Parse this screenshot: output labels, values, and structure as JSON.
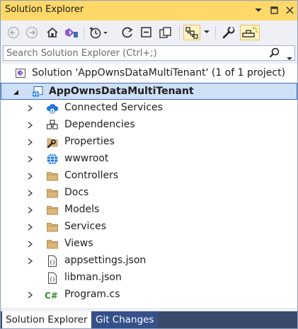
{
  "window": {
    "title": "Solution Explorer",
    "controls": [
      "dropdown-icon",
      "maximize-icon",
      "close-icon"
    ]
  },
  "toolbar": {
    "buttons": [
      {
        "name": "back-icon"
      },
      {
        "name": "forward-icon"
      },
      {
        "name": "home-icon"
      },
      {
        "name": "vs-switch-views-icon"
      },
      {
        "name": "pending-changes-filter-icon"
      },
      {
        "name": "refresh-icon"
      },
      {
        "name": "collapse-all-icon"
      },
      {
        "name": "show-all-files-icon"
      },
      {
        "name": "sync-with-active-document-icon"
      },
      {
        "name": "properties-wrench-icon"
      },
      {
        "name": "preview-selected-items-icon"
      }
    ]
  },
  "search": {
    "placeholder": "Search Solution Explorer (Ctrl+;)"
  },
  "tree": {
    "solution_label": "Solution 'AppOwnsDataMultiTenant' (1 of 1 project)",
    "project_label": "AppOwnsDataMultiTenant",
    "items": [
      {
        "label": "Connected Services",
        "icon": "connected-services-icon",
        "expandable": true
      },
      {
        "label": "Dependencies",
        "icon": "dependencies-icon",
        "expandable": true
      },
      {
        "label": "Properties",
        "icon": "properties-folder-icon",
        "expandable": true
      },
      {
        "label": "wwwroot",
        "icon": "globe-icon",
        "expandable": true
      },
      {
        "label": "Controllers",
        "icon": "folder-icon",
        "expandable": true
      },
      {
        "label": "Docs",
        "icon": "folder-icon",
        "expandable": true
      },
      {
        "label": "Models",
        "icon": "folder-icon",
        "expandable": true
      },
      {
        "label": "Services",
        "icon": "folder-icon",
        "expandable": true
      },
      {
        "label": "Views",
        "icon": "folder-icon",
        "expandable": true
      },
      {
        "label": "appsettings.json",
        "icon": "json-file-icon",
        "expandable": true
      },
      {
        "label": "libman.json",
        "icon": "json-file-icon",
        "expandable": false
      },
      {
        "label": "Program.cs",
        "icon": "csharp-file-icon",
        "expandable": true
      }
    ]
  },
  "tabs": {
    "active": "Solution Explorer",
    "inactive": "Git Changes"
  },
  "colors": {
    "title_bar": "#ffd86a",
    "selection_fill": "#cde0f7",
    "selection_border": "#3d6fb5",
    "tab_strip": "#3b4a6a",
    "folder": "#dcb67a"
  }
}
